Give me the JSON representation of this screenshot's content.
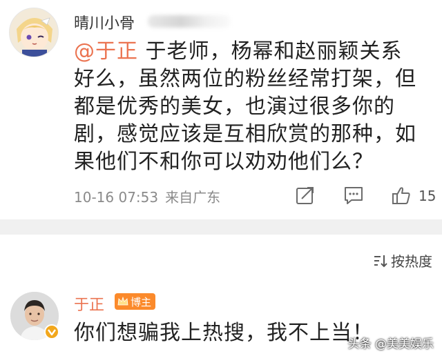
{
  "post": {
    "username": "晴川小骨",
    "mention": "@于正",
    "text": " 于老师，杨幂和赵丽颖关系好么，虽然两位的粉丝经常打架，但都是优秀的美女，也演过很多你的剧，感觉应该是互相欣赏的那种，如果他们不和你可以劝劝他们么？",
    "timestamp": "10-16 07:53",
    "source": "来自广东",
    "like_count": "15",
    "icons": {
      "share": "share-icon",
      "comment": "comment-icon",
      "like": "thumbs-up-icon"
    }
  },
  "sort": {
    "label": "按热度",
    "icon": "sort-icon"
  },
  "reply": {
    "name": "于正",
    "tag": "博主",
    "text": "你们想骗我上热搜，我不上当！"
  },
  "watermark": "头条 @美美娱乐",
  "colors": {
    "accent": "#eb7350",
    "tag": "#fb8a2b",
    "meta": "#8a8a8a",
    "divider": "#f0f0f0"
  }
}
